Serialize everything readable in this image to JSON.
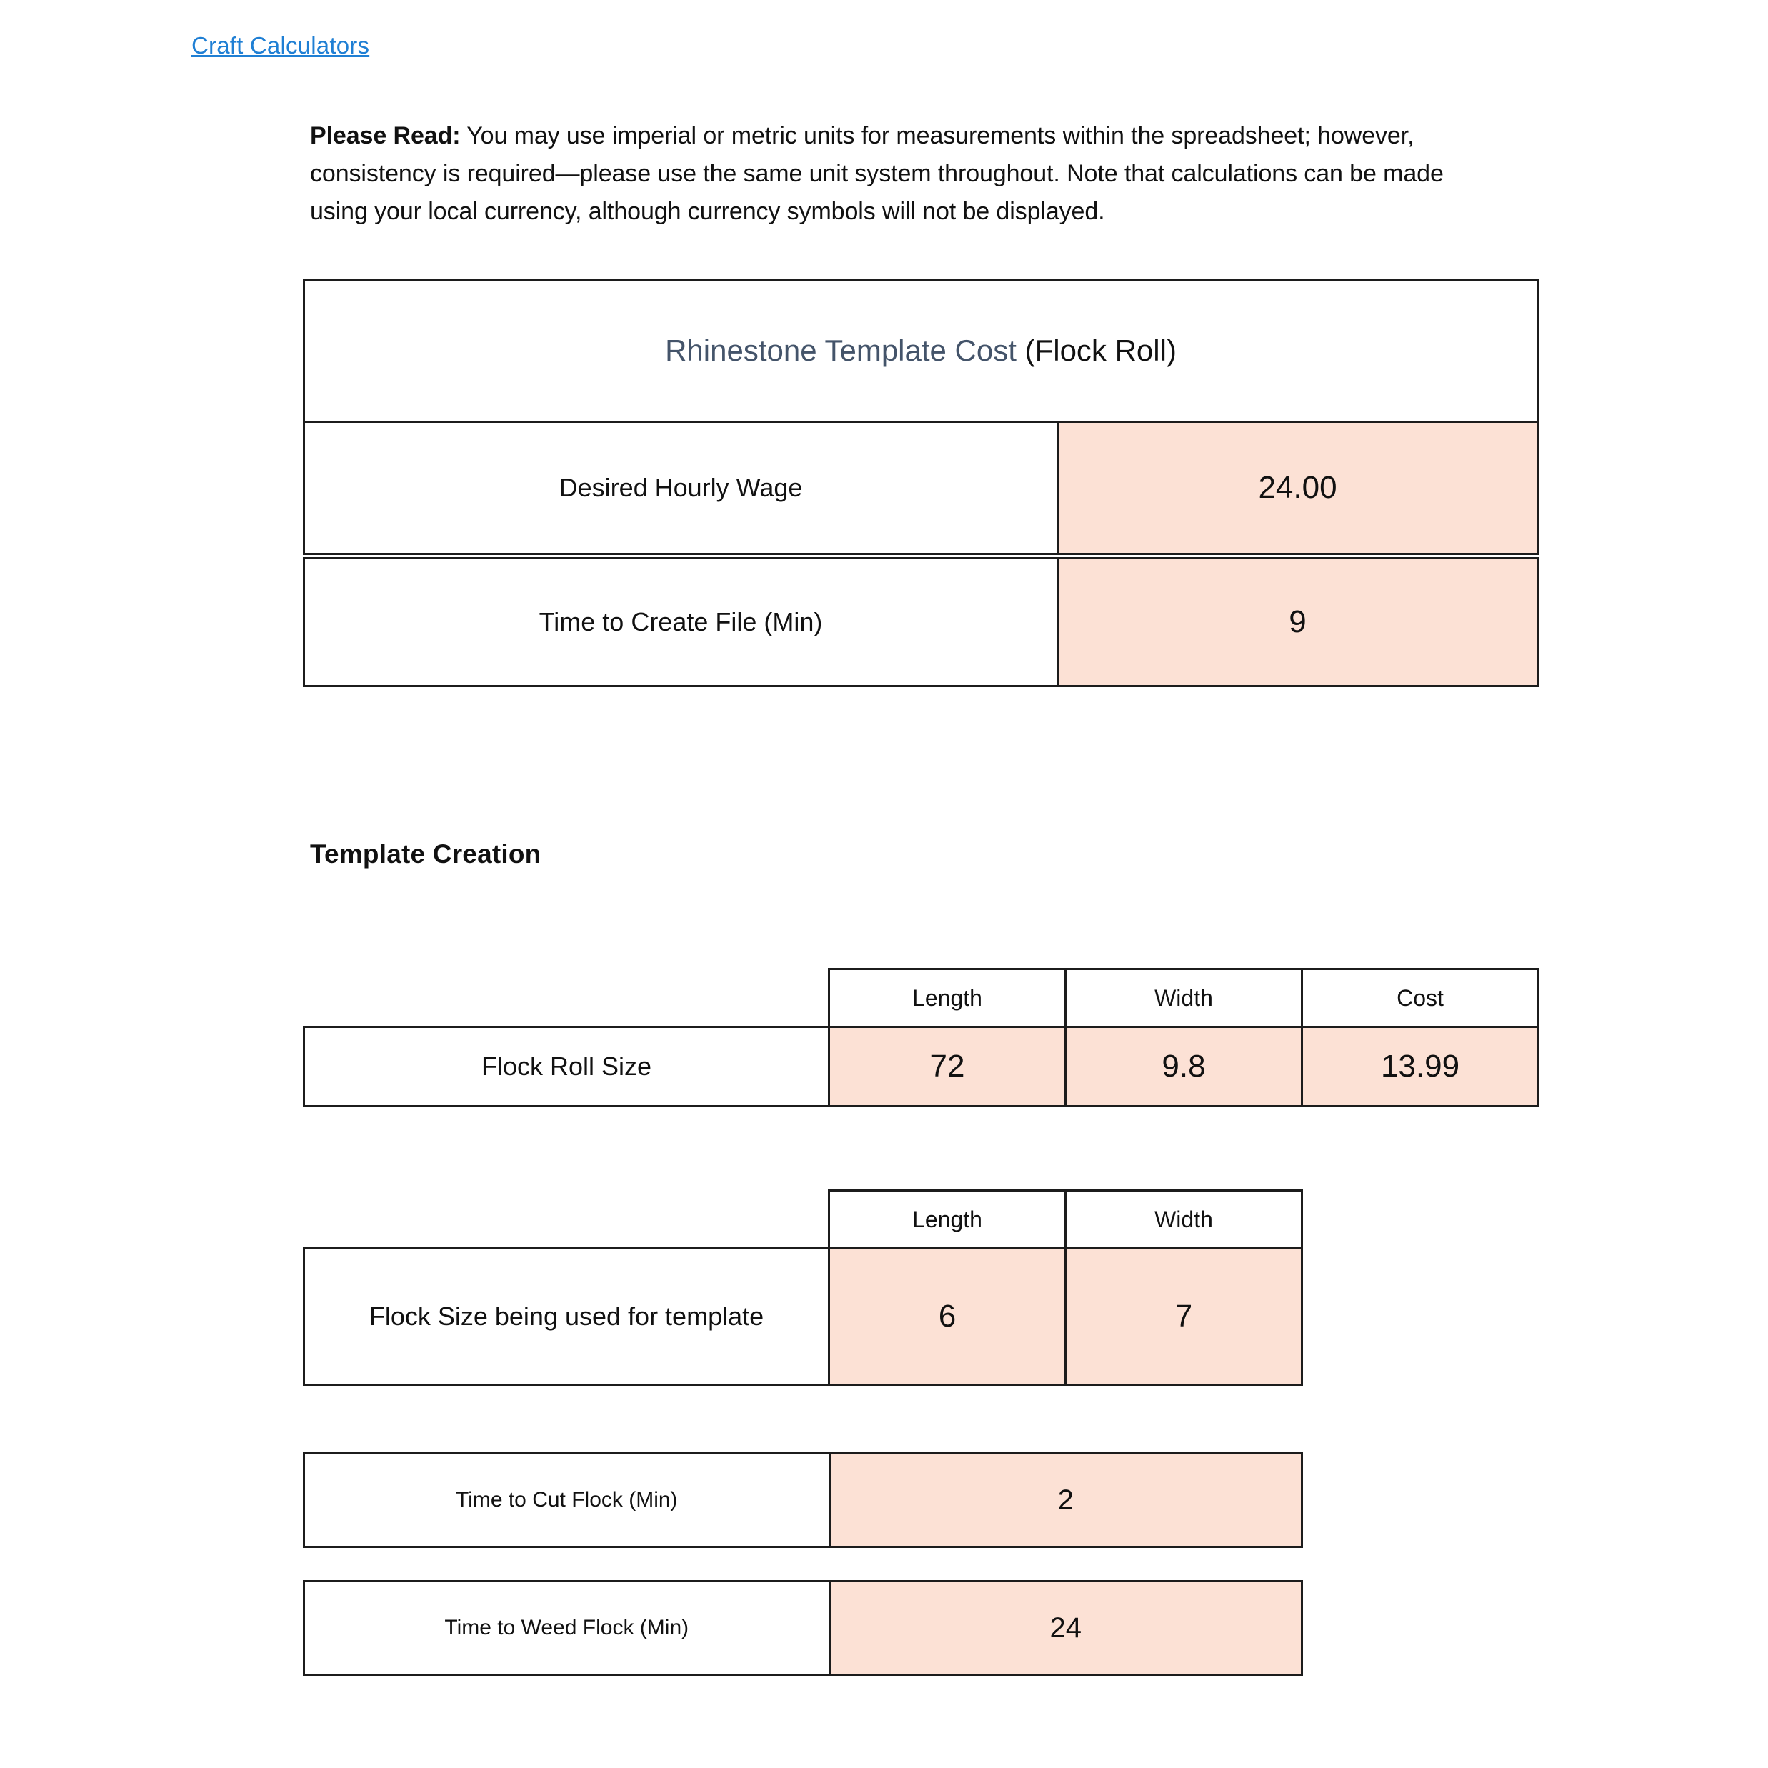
{
  "nav": {
    "link_label": "Craft Calculators",
    "link_color": "#1f7fd4"
  },
  "notice": {
    "label": "Please Read:",
    "body": " You may use imperial or metric units for measurements within the spreadsheet; however, consistency is required—please use the same unit system throughout. Note that calculations can be made using your local currency, although currency symbols will not be displayed."
  },
  "colors": {
    "input_fill": "#FCE1D5",
    "border": "#1C1C1C",
    "title_accent": "#44546A"
  },
  "rhinestone_table": {
    "title_main": "Rhinestone Template Cost",
    "title_sub": " (Flock Roll)",
    "wage_label": "Desired Hourly Wage",
    "wage_value": "24.00"
  },
  "create_file_table": {
    "label": "Time to Create File (Min)",
    "value": "9"
  },
  "section": {
    "heading": "Template Creation"
  },
  "flock_roll_table": {
    "headers": [
      "Length",
      "Width",
      "Cost"
    ],
    "row_label": "Flock Roll Size",
    "values": [
      "72",
      "9.8",
      "13.99"
    ]
  },
  "flock_size_table": {
    "headers": [
      "Length",
      "Width"
    ],
    "row_label": "Flock Size being used for template",
    "values": [
      "6",
      "7"
    ]
  },
  "cut_flock_table": {
    "label": "Time to Cut Flock (Min)",
    "value": "2"
  },
  "weed_flock_table": {
    "label": "Time to Weed Flock (Min)",
    "value": "24"
  }
}
